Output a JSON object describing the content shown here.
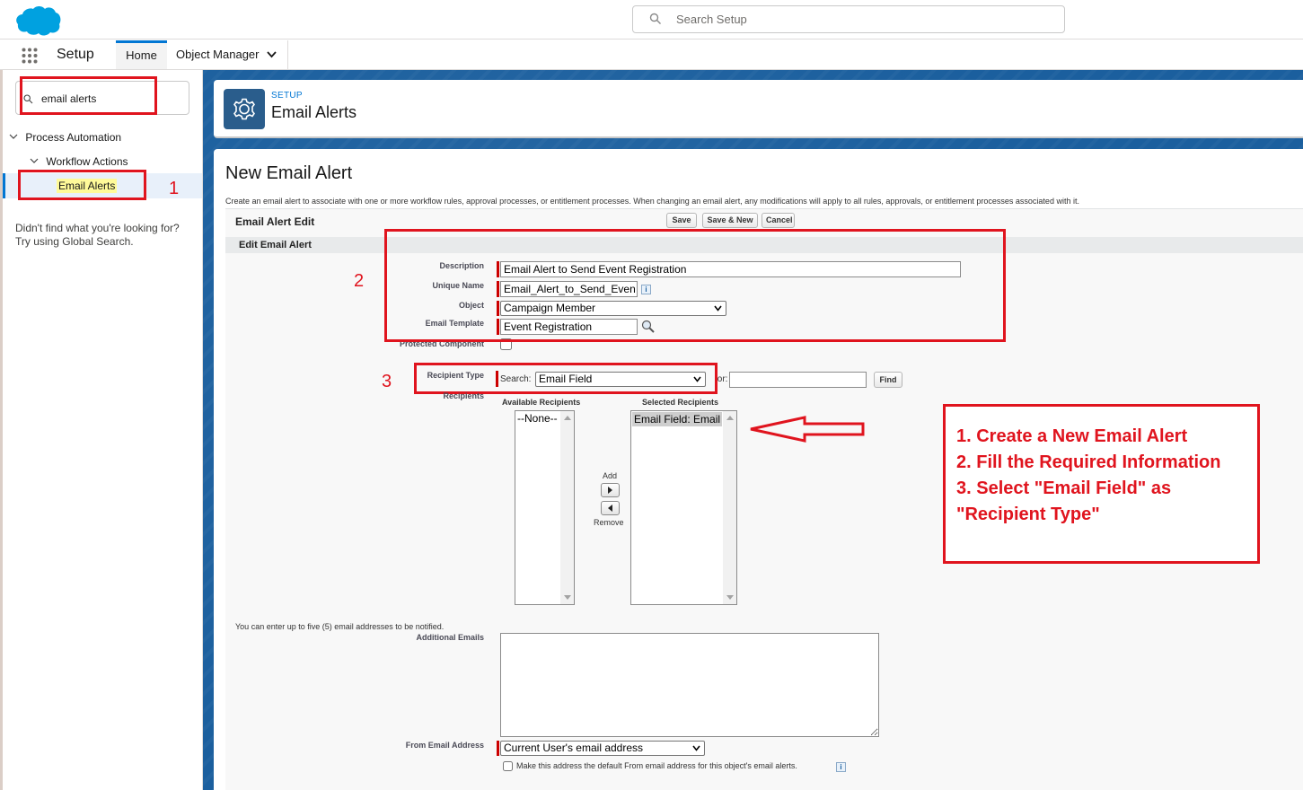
{
  "header": {
    "global_search_placeholder": "Search Setup"
  },
  "nav": {
    "app_name": "Setup",
    "tabs": [
      {
        "label": "Home"
      },
      {
        "label": "Object Manager"
      }
    ]
  },
  "sidebar": {
    "quick_find_value": "email alerts",
    "tree": {
      "group": "Process Automation",
      "subgroup": "Workflow Actions",
      "item": "Email Alerts"
    },
    "help_line1": "Didn't find what you're looking for?",
    "help_line2": "Try using Global Search."
  },
  "page_header": {
    "eyebrow": "SETUP",
    "title": "Email Alerts"
  },
  "form": {
    "page_title": "New Email Alert",
    "intro": "Create an email alert to associate with one or more workflow rules, approval processes, or entitlement processes. When changing an email alert, any modifications will apply to all rules, approvals, or entitlement processes associated with it.",
    "block_title": "Email Alert Edit",
    "buttons": {
      "save": "Save",
      "save_new": "Save & New",
      "cancel": "Cancel",
      "find": "Find"
    },
    "section_title": "Edit Email Alert",
    "labels": {
      "description": "Description",
      "unique_name": "Unique Name",
      "object": "Object",
      "email_template": "Email Template",
      "protected_component": "Protected Component",
      "recipient_type": "Recipient Type",
      "recipients": "Recipients",
      "additional_emails": "Additional Emails",
      "from_email_address": "From Email Address"
    },
    "values": {
      "description": "Email Alert to Send Event Registration",
      "unique_name": "Email_Alert_to_Send_Even",
      "object": "Campaign Member",
      "email_template": "Event Registration",
      "search_label": "Search:",
      "recipient_type": "Email Field",
      "for_label": "for:",
      "from_email_address": "Current User's email address"
    },
    "recipients": {
      "available_header": "Available Recipients",
      "selected_header": "Selected Recipients",
      "available_items": [
        "--None--"
      ],
      "selected_items": [
        "Email Field: Email"
      ],
      "add_label": "Add",
      "remove_label": "Remove"
    },
    "additional_note": "You can enter up to five (5) email addresses to be notified.",
    "default_from_label": "Make this address the default From email address for this object's email alerts."
  },
  "annotations": {
    "num1": "1",
    "num2": "2",
    "num3": "3",
    "notes": [
      "1. Create a New Email Alert",
      "2. Fill the Required Information",
      "3. Select \"Email Field\" as",
      "\"Recipient Type\""
    ],
    "color": "#e0141e"
  },
  "colors": {
    "brand": "#0176d3",
    "setup_background": "#1b5f9e",
    "required": "#c00000"
  }
}
